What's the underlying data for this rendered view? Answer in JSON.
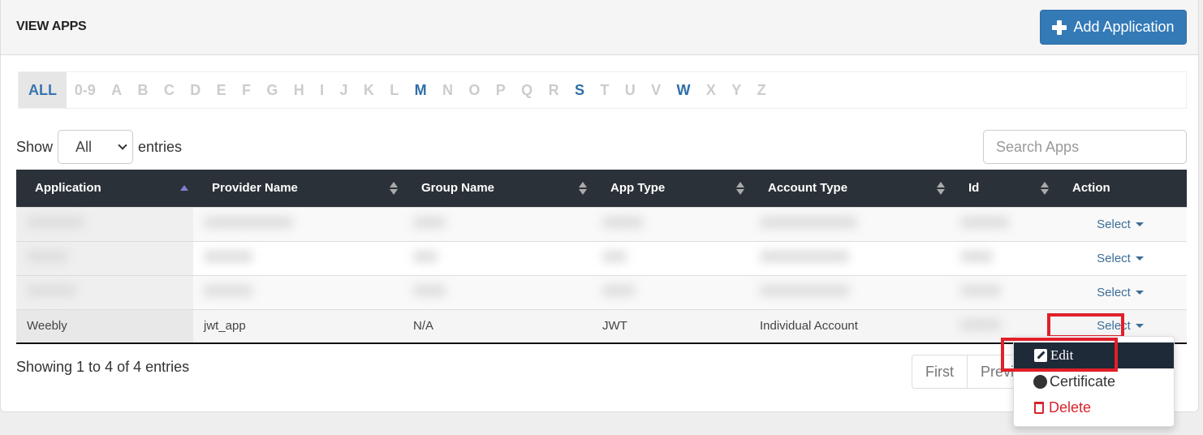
{
  "header": {
    "title": "VIEW APPS",
    "add_button_label": "Add Application"
  },
  "alpha_filter": [
    {
      "label": "ALL",
      "state": "active"
    },
    {
      "label": "0-9",
      "state": "empty"
    },
    {
      "label": "A",
      "state": "empty"
    },
    {
      "label": "B",
      "state": "empty"
    },
    {
      "label": "C",
      "state": "empty"
    },
    {
      "label": "D",
      "state": "empty"
    },
    {
      "label": "E",
      "state": "empty"
    },
    {
      "label": "F",
      "state": "empty"
    },
    {
      "label": "G",
      "state": "empty"
    },
    {
      "label": "H",
      "state": "empty"
    },
    {
      "label": "I",
      "state": "empty"
    },
    {
      "label": "J",
      "state": "empty"
    },
    {
      "label": "K",
      "state": "empty"
    },
    {
      "label": "L",
      "state": "empty"
    },
    {
      "label": "M",
      "state": "has"
    },
    {
      "label": "N",
      "state": "empty"
    },
    {
      "label": "O",
      "state": "empty"
    },
    {
      "label": "P",
      "state": "empty"
    },
    {
      "label": "Q",
      "state": "empty"
    },
    {
      "label": "R",
      "state": "empty"
    },
    {
      "label": "S",
      "state": "has"
    },
    {
      "label": "T",
      "state": "empty"
    },
    {
      "label": "U",
      "state": "empty"
    },
    {
      "label": "V",
      "state": "empty"
    },
    {
      "label": "W",
      "state": "has"
    },
    {
      "label": "X",
      "state": "empty"
    },
    {
      "label": "Y",
      "state": "empty"
    },
    {
      "label": "Z",
      "state": "empty"
    }
  ],
  "length_control": {
    "prefix": "Show",
    "selected": "All",
    "suffix": "entries"
  },
  "search": {
    "placeholder": "Search Apps",
    "value": ""
  },
  "table": {
    "columns": [
      "Application",
      "Provider Name",
      "Group Name",
      "App Type",
      "Account Type",
      "Id",
      "Action"
    ],
    "rows": [
      {
        "application": "",
        "provider": "",
        "group": "",
        "app_type": "",
        "account_type": "",
        "id": "",
        "action": "Select",
        "redacted": true
      },
      {
        "application": "",
        "provider": "",
        "group": "",
        "app_type": "",
        "account_type": "",
        "id": "",
        "action": "Select",
        "redacted": true
      },
      {
        "application": "",
        "provider": "",
        "group": "",
        "app_type": "",
        "account_type": "",
        "id": "",
        "action": "Select",
        "redacted": true
      },
      {
        "application": "Weebly",
        "provider": "jwt_app",
        "group": "N/A",
        "app_type": "JWT",
        "account_type": "Individual Account",
        "id": "",
        "action": "Select",
        "redacted": false
      }
    ]
  },
  "footer": {
    "info": "Showing 1 to 4 of 4 entries",
    "pagination": [
      "First",
      "Previous"
    ]
  },
  "action_menu": {
    "items": [
      {
        "label": "Edit",
        "icon": "edit-icon"
      },
      {
        "label": "Certificate",
        "icon": "certificate-icon"
      },
      {
        "label": "Delete",
        "icon": "trash-icon"
      }
    ]
  },
  "colors": {
    "primary": "#337ab7",
    "table_header": "#2b3138",
    "link": "#3b6e98",
    "danger": "#d9232e",
    "highlight": "#e0202a"
  }
}
